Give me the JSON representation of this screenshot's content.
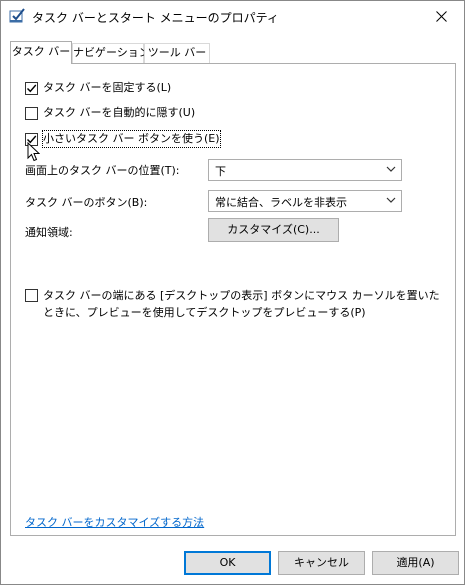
{
  "window": {
    "title": "タスク バーとスタート メニューのプロパティ"
  },
  "tabs": [
    {
      "label": "タスク バー",
      "active": true
    },
    {
      "label": "ナビゲーション",
      "active": false
    },
    {
      "label": "ツール バー",
      "active": false
    }
  ],
  "options": {
    "lock_taskbar": {
      "label": "タスク バーを固定する(L)",
      "checked": true
    },
    "auto_hide": {
      "label": "タスク バーを自動的に隠す(U)",
      "checked": false
    },
    "small_buttons": {
      "label": "小さいタスク バー ボタンを使う(E)",
      "checked": true
    }
  },
  "position": {
    "label": "画面上のタスク バーの位置(T):",
    "value": "下"
  },
  "buttons": {
    "label": "タスク バーのボタン(B):",
    "value": "常に結合、ラベルを非表示"
  },
  "notify": {
    "label": "通知領域:",
    "button": "カスタマイズ(C)..."
  },
  "peek": {
    "label": "タスク バーの端にある [デスクトップの表示] ボタンにマウス カーソルを置いたときに、プレビューを使用してデスクトップをプレビューする(P)",
    "checked": false
  },
  "help_link": "タスク バーをカスタマイズする方法",
  "footer": {
    "ok": "OK",
    "cancel": "キャンセル",
    "apply": "適用(A)"
  }
}
